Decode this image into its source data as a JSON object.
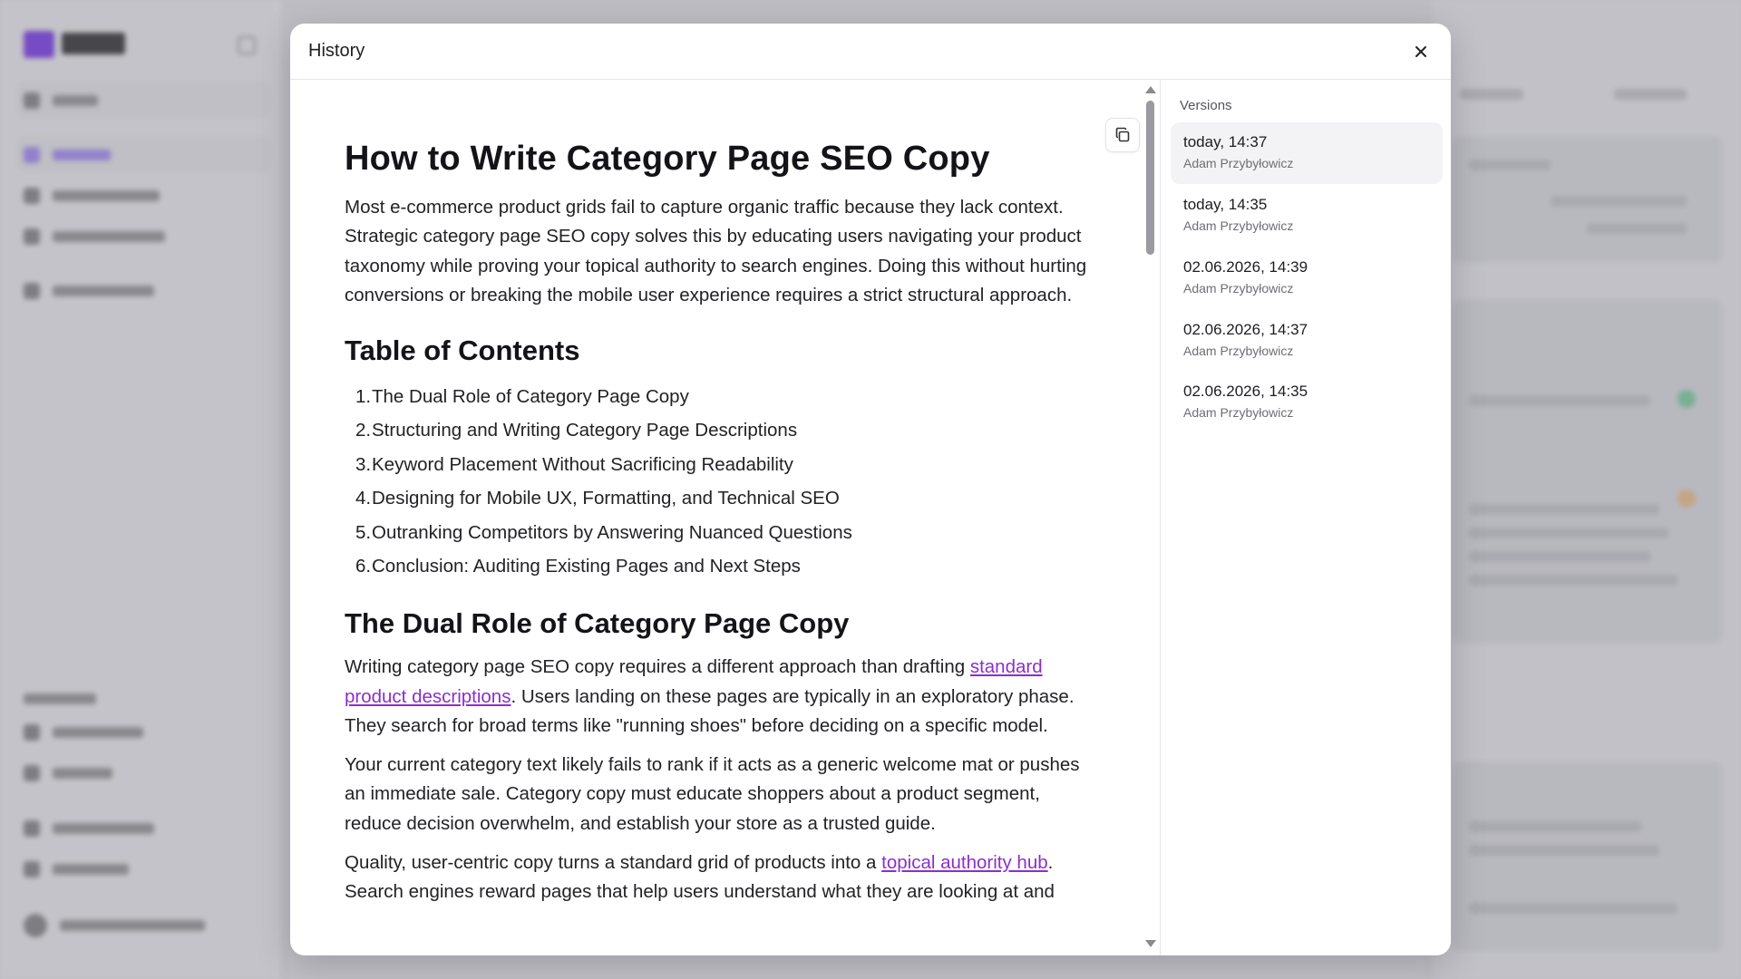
{
  "modal": {
    "title": "History",
    "close_icon": "close-icon",
    "copy_icon": "copy-icon"
  },
  "article": {
    "title": "How to Write Category Page SEO Copy",
    "intro": "Most e-commerce product grids fail to capture organic traffic because they lack context. Strategic category page SEO copy solves this by educating users navigating your product taxonomy while proving your topical authority to search engines. Doing this without hurting conversions or breaking the mobile user experience requires a strict structural approach.",
    "toc_heading": "Table of Contents",
    "toc": [
      {
        "num": "1.",
        "text": "The Dual Role of Category Page Copy"
      },
      {
        "num": "2.",
        "text": "Structuring and Writing Category Page Descriptions"
      },
      {
        "num": "3.",
        "text": "Keyword Placement Without Sacrificing Readability"
      },
      {
        "num": "4.",
        "text": "Designing for Mobile UX, Formatting, and Technical SEO"
      },
      {
        "num": "5.",
        "text": "Outranking Competitors by Answering Nuanced Questions"
      },
      {
        "num": "6.",
        "text": "Conclusion: Auditing Existing Pages and Next Steps"
      }
    ],
    "section1_heading": "The Dual Role of Category Page Copy",
    "p1_before": "Writing category page SEO copy requires a different approach than drafting ",
    "p1_link": "standard product descriptions",
    "p1_after": ". Users landing on these pages are typically in an exploratory phase. They search for broad terms like \"running shoes\" before deciding on a specific model.",
    "p2": "Your current category text likely fails to rank if it acts as a generic welcome mat or pushes an immediate sale. Category copy must educate shoppers about a product segment, reduce decision overwhelm, and establish your store as a trusted guide.",
    "p3_before": "Quality, user-centric copy turns a standard grid of products into a ",
    "p3_link": "topical authority hub",
    "p3_after": ".",
    "p4": "Search engines reward pages that help users understand what they are looking at and"
  },
  "versions": {
    "label": "Versions",
    "items": [
      {
        "time": "today, 14:37",
        "author": "Adam Przybyłowicz",
        "selected": true
      },
      {
        "time": "today, 14:35",
        "author": "Adam Przybyłowicz",
        "selected": false
      },
      {
        "time": "02.06.2026, 14:39",
        "author": "Adam Przybyłowicz",
        "selected": false
      },
      {
        "time": "02.06.2026, 14:37",
        "author": "Adam Przybyłowicz",
        "selected": false
      },
      {
        "time": "02.06.2026, 14:35",
        "author": "Adam Przybyłowicz",
        "selected": false
      }
    ]
  },
  "colors": {
    "link": "#8b2fc9",
    "brand": "#7c3aed",
    "selected_version_bg": "#f3f3f5"
  }
}
